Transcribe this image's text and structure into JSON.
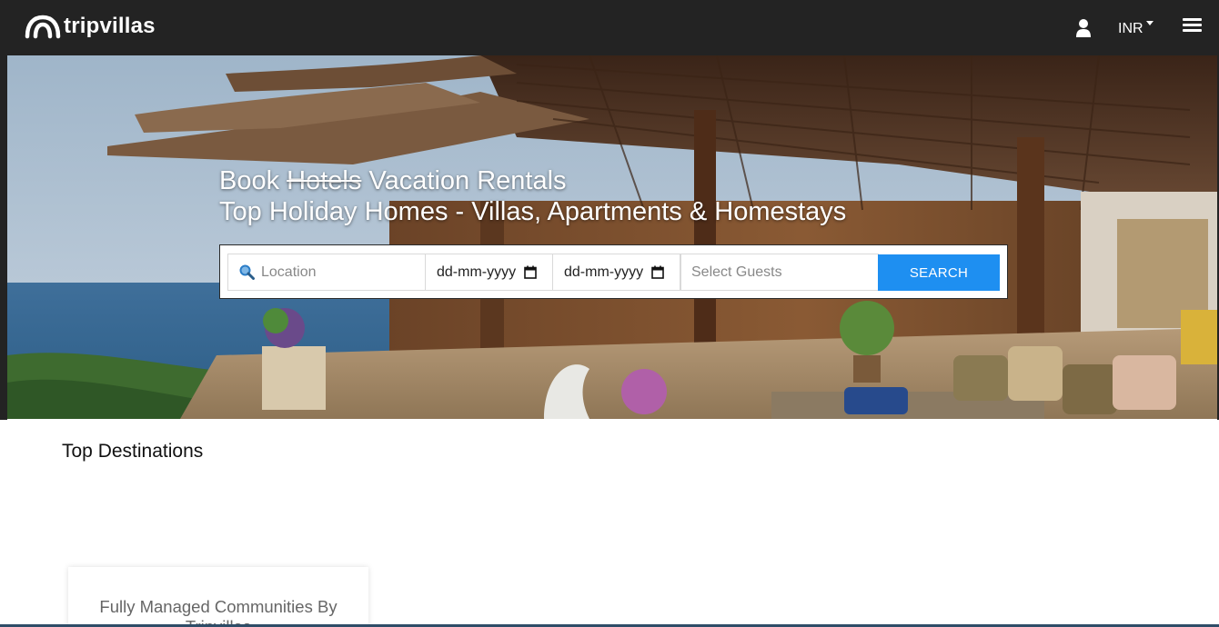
{
  "brand": {
    "logo_text": "tripvillas"
  },
  "nav": {
    "user_icon": "user-icon",
    "currency": "INR",
    "menu_icon": "hamburger-menu-icon"
  },
  "hero": {
    "headline_book": "Book",
    "headline_struck": "Hotels",
    "headline_rest": "Vacation Rentals",
    "subheadline": "Top Holiday Homes - Villas, Apartments & Homestays"
  },
  "search": {
    "location_placeholder": "Location",
    "checkin_value": "dd-mm-yyyy",
    "checkout_value": "dd-mm-yyyy",
    "guests_placeholder": "Select Guests",
    "button_label": "SEARCH"
  },
  "sections": {
    "top_destinations_title": "Top Destinations",
    "card_title": "Fully Managed Communities By Tripvillas"
  },
  "colors": {
    "navbar_bg": "#232323",
    "search_button": "#1e8ff1",
    "bottom_line": "#2f4d68"
  }
}
